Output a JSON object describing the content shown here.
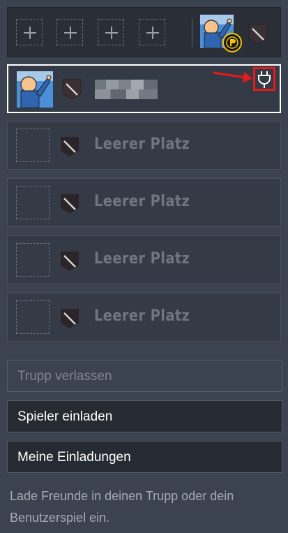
{
  "colors": {
    "background": "#3c4350",
    "panel_dark": "#2a2e37",
    "selected_border": "#ffffff",
    "highlight_red": "#e21b1b",
    "badge_yellow": "#f5c400"
  },
  "top_bar": {
    "add_slot_icon": "plus-icon",
    "add_slot_count": 4,
    "leader_badge_icon": "crown-emblem-icon",
    "rank_icon": "shield-rank-icon"
  },
  "player": {
    "name": "",
    "rank_icon": "shield-rank-icon",
    "connection_icon": "plug-icon"
  },
  "slots": [
    {
      "label": "Leerer Platz"
    },
    {
      "label": "Leerer Platz"
    },
    {
      "label": "Leerer Platz"
    },
    {
      "label": "Leerer Platz"
    }
  ],
  "buttons": {
    "leave": "Trupp verlassen",
    "invite": "Spieler einladen",
    "my_invites": "Meine Einladungen"
  },
  "hint": "Lade Freunde in deinen Trupp oder dein Benutzerspiel ein."
}
